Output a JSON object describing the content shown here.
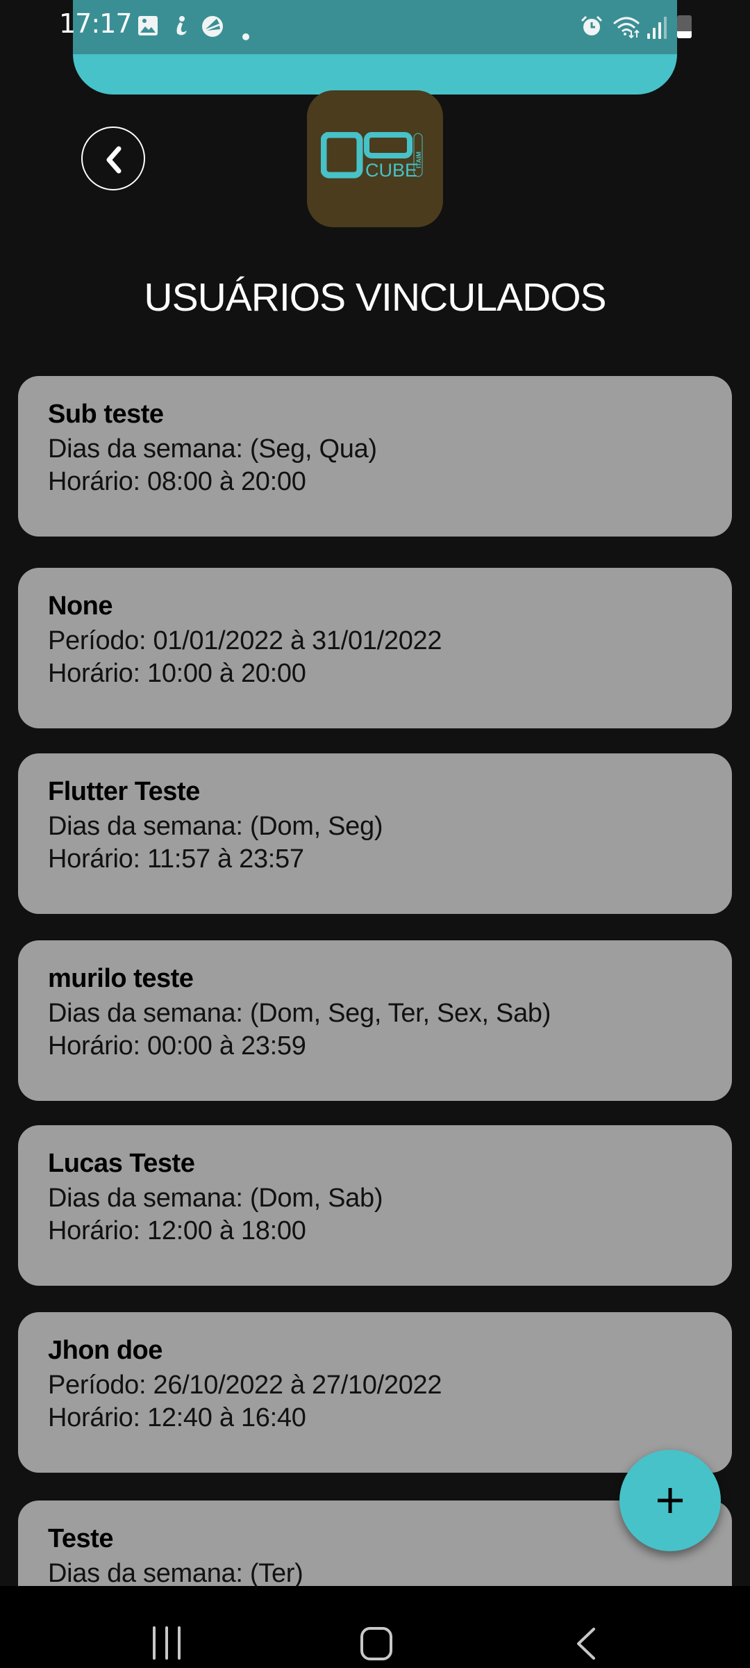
{
  "status_bar": {
    "time": "17:17",
    "left_icons": [
      "gallery-icon",
      "samsung-health-icon",
      "app-notification-icon",
      "more-notifications-dot-icon"
    ],
    "right_icons": [
      "alarm-icon",
      "wifi-icon",
      "signal-icon",
      "battery-icon"
    ],
    "battery_level": 0.3
  },
  "header": {
    "back_label": "Voltar",
    "logo_text": "CUBE",
    "logo_subtext": "ITAIM",
    "title": "USUÁRIOS VINCULADOS"
  },
  "colors": {
    "accent": "#47c2c9",
    "status_dark": "#3a8f94",
    "background": "#111111",
    "card": "#9e9e9e",
    "logo_bg": "#4a3c1d"
  },
  "users": [
    {
      "name": "Sub teste",
      "line1": "Dias da semana: (Seg, Qua)",
      "line2": "Horário: 08:00 à 20:00"
    },
    {
      "name": "None",
      "line1": "Período: 01/01/2022 à 31/01/2022",
      "line2": "Horário: 10:00 à 20:00"
    },
    {
      "name": "Flutter Teste",
      "line1": "Dias da semana: (Dom, Seg)",
      "line2": "Horário: 11:57 à 23:57"
    },
    {
      "name": "murilo teste",
      "line1": "Dias da semana: (Dom, Seg, Ter, Sex, Sab)",
      "line2": "Horário: 00:00 à 23:59"
    },
    {
      "name": "Lucas Teste",
      "line1": "Dias da semana: (Dom, Sab)",
      "line2": "Horário: 12:00 à 18:00"
    },
    {
      "name": "Jhon doe",
      "line1": "Período: 26/10/2022 à 27/10/2022",
      "line2": "Horário: 12:40 à 16:40"
    },
    {
      "name": "Teste",
      "line1": "Dias da semana: (Ter)",
      "line2": ""
    }
  ],
  "fab": {
    "icon": "plus-icon",
    "label": "Adicionar usuário"
  },
  "nav_bar": {
    "items": [
      "recents-icon",
      "home-icon",
      "back-icon"
    ]
  }
}
